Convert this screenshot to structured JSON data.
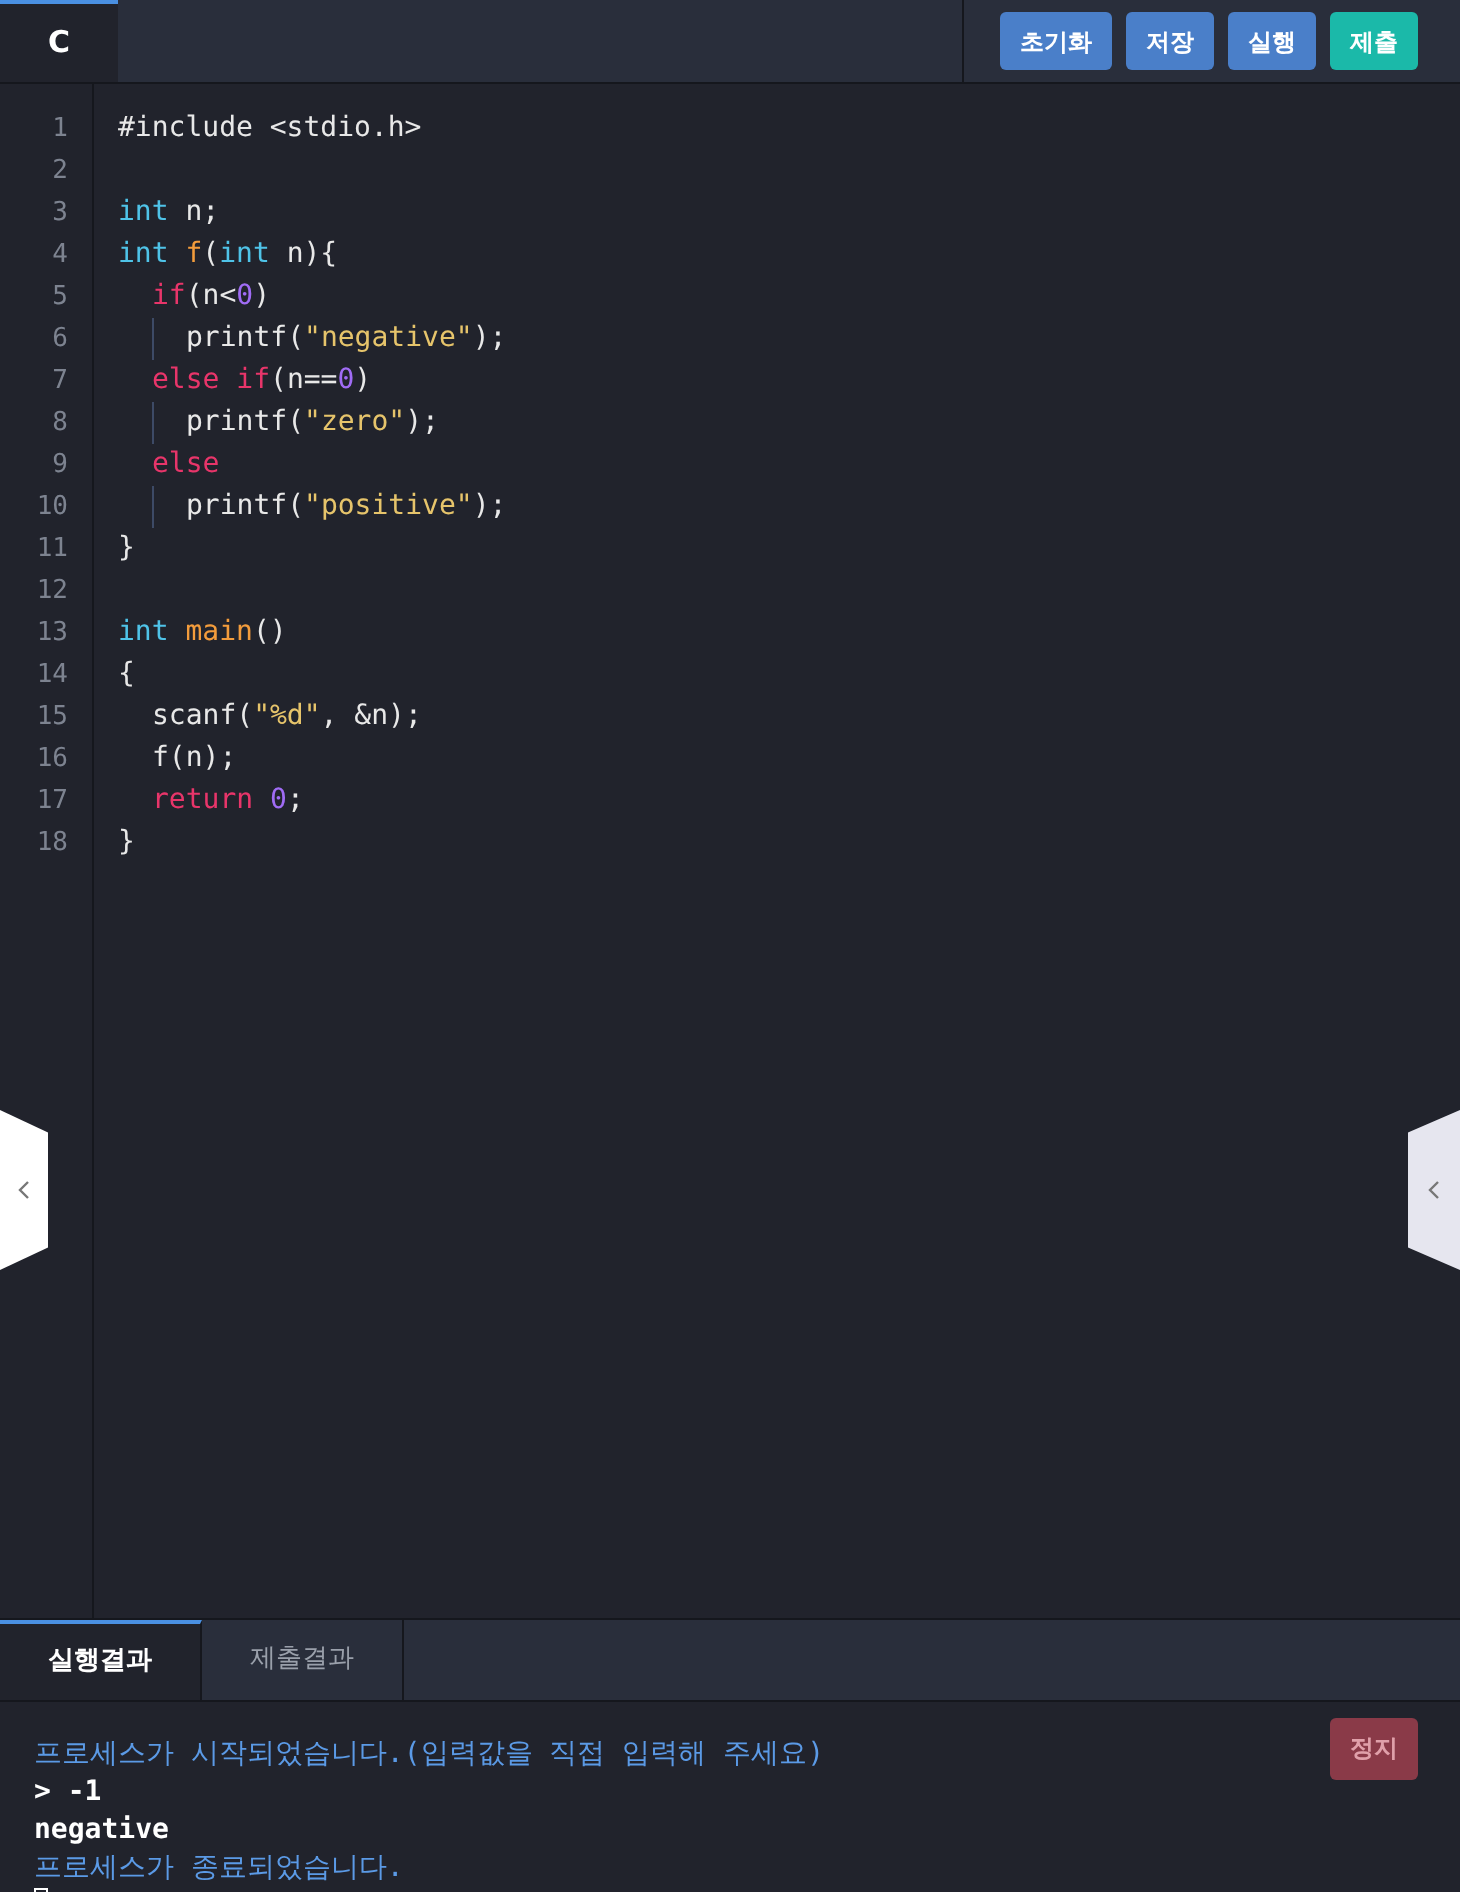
{
  "language_tab": {
    "label": "C",
    "selected": true
  },
  "toolbar_buttons": [
    {
      "label": "초기화",
      "kind": "primary"
    },
    {
      "label": "저장",
      "kind": "primary"
    },
    {
      "label": "실행",
      "kind": "primary"
    },
    {
      "label": "제출",
      "kind": "submit"
    }
  ],
  "code_lines": [
    {
      "number": "1",
      "kind": "top",
      "tokens": [
        {
          "text": "#include <stdio.h>",
          "kind": "plain"
        }
      ]
    },
    {
      "number": "2",
      "kind": "top"
    },
    {
      "number": "3",
      "kind": "top",
      "tokens": [
        {
          "text": "int ",
          "kind": "type"
        },
        {
          "text": "n;",
          "kind": "plain"
        }
      ]
    },
    {
      "number": "4",
      "kind": "top",
      "tokens": [
        {
          "text": "int ",
          "kind": "type"
        },
        {
          "text": "f",
          "kind": "func"
        },
        {
          "text": "(",
          "kind": "plain"
        },
        {
          "text": "int ",
          "kind": "type"
        },
        {
          "text": "n){",
          "kind": "plain"
        }
      ]
    },
    {
      "number": "5",
      "kind": "indented",
      "tokens": [
        {
          "text": "if",
          "kind": "keyword"
        },
        {
          "text": "(n<",
          "kind": "plain"
        },
        {
          "text": "0",
          "kind": "number"
        },
        {
          "text": ")",
          "kind": "plain"
        }
      ]
    },
    {
      "number": "6",
      "kind": "nested",
      "tokens": [
        {
          "text": "printf(",
          "kind": "plain"
        },
        {
          "text": "\"negative\"",
          "kind": "string"
        },
        {
          "text": ");",
          "kind": "plain"
        }
      ]
    },
    {
      "number": "7",
      "kind": "indented",
      "tokens": [
        {
          "text": "else if",
          "kind": "keyword"
        },
        {
          "text": "(n==",
          "kind": "plain"
        },
        {
          "text": "0",
          "kind": "number"
        },
        {
          "text": ")",
          "kind": "plain"
        }
      ]
    },
    {
      "number": "8",
      "kind": "nested",
      "tokens": [
        {
          "text": "printf(",
          "kind": "plain"
        },
        {
          "text": "\"zero\"",
          "kind": "string"
        },
        {
          "text": ");",
          "kind": "plain"
        }
      ]
    },
    {
      "number": "9",
      "kind": "indented",
      "tokens": [
        {
          "text": "else",
          "kind": "keyword"
        }
      ]
    },
    {
      "number": "10",
      "kind": "nested",
      "tokens": [
        {
          "text": "printf(",
          "kind": "plain"
        },
        {
          "text": "\"positive\"",
          "kind": "string"
        },
        {
          "text": ");",
          "kind": "plain"
        }
      ]
    },
    {
      "number": "11",
      "kind": "top",
      "tokens": [
        {
          "text": "}",
          "kind": "plain"
        }
      ]
    },
    {
      "number": "12",
      "kind": "top"
    },
    {
      "number": "13",
      "kind": "top",
      "tokens": [
        {
          "text": "int ",
          "kind": "type"
        },
        {
          "text": "main",
          "kind": "func"
        },
        {
          "text": "()",
          "kind": "plain"
        }
      ]
    },
    {
      "number": "14",
      "kind": "top",
      "tokens": [
        {
          "text": "{",
          "kind": "plain"
        }
      ]
    },
    {
      "number": "15",
      "kind": "indented",
      "tokens": [
        {
          "text": "scanf(",
          "kind": "plain"
        },
        {
          "text": "\"%d\"",
          "kind": "string"
        },
        {
          "text": ", &n);",
          "kind": "plain"
        }
      ]
    },
    {
      "number": "16",
      "kind": "indented",
      "tokens": [
        {
          "text": "f(n);",
          "kind": "plain"
        }
      ]
    },
    {
      "number": "17",
      "kind": "indented",
      "tokens": [
        {
          "text": "return ",
          "kind": "keyword"
        },
        {
          "text": "0",
          "kind": "number"
        },
        {
          "text": ";",
          "kind": "plain"
        }
      ]
    },
    {
      "number": "18",
      "kind": "top",
      "tokens": [
        {
          "text": "}",
          "kind": "plain"
        }
      ]
    }
  ],
  "result_tabs": [
    {
      "label": "실행결과",
      "selected": true
    },
    {
      "label": "제출결과",
      "selected": false
    }
  ],
  "stop_button": {
    "label": "정지",
    "disabled": true
  },
  "output_lines": [
    {
      "text": "프로세스가 시작되었습니다.(입력값을 직접 입력해 주세요)",
      "kind": "info"
    },
    {
      "text": "> -1",
      "kind": "io"
    },
    {
      "text": "negative",
      "kind": "io"
    },
    {
      "text": "프로세스가 종료되었습니다.",
      "kind": "info"
    }
  ]
}
